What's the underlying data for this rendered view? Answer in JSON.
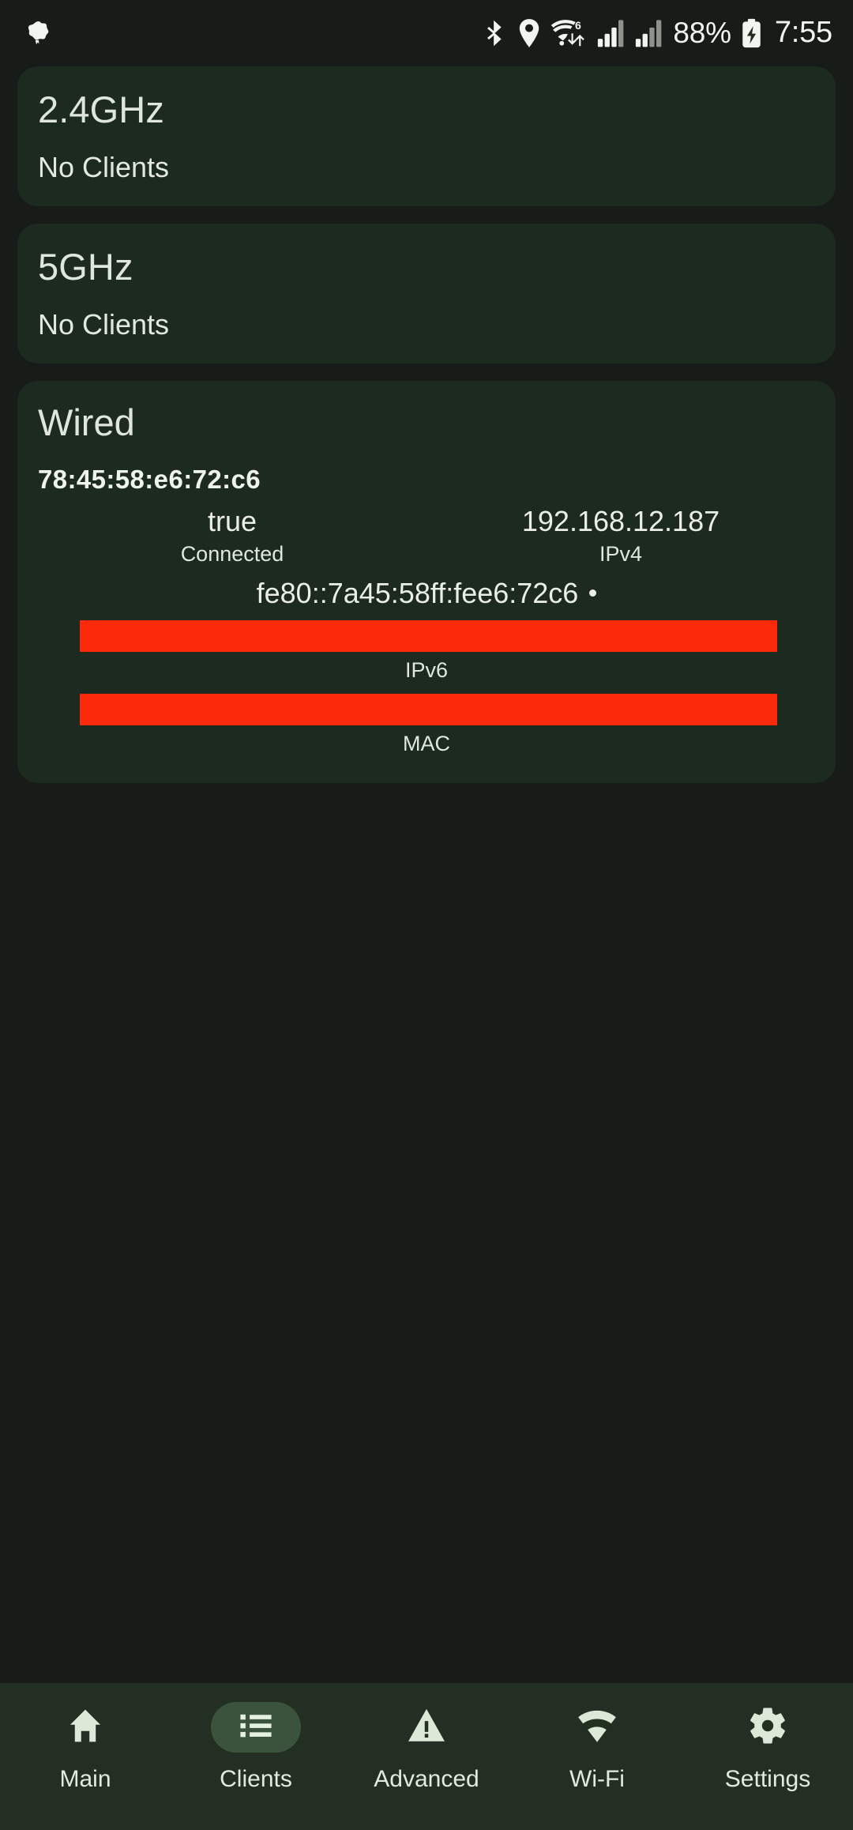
{
  "status_bar": {
    "left_icon": "app-notification-icon",
    "icons": [
      "bluetooth-icon",
      "location-pin-icon",
      "wifi-6-icon",
      "signal-bars-1-icon",
      "signal-bars-2-icon"
    ],
    "battery_percent": "88%",
    "battery_icon": "battery-charging-icon",
    "time": "7:55"
  },
  "cards": [
    {
      "title": "2.4GHz",
      "subtitle": "No Clients"
    },
    {
      "title": "5GHz",
      "subtitle": "No Clients"
    }
  ],
  "wired": {
    "title": "Wired",
    "mac_heading": "78:45:58:e6:72:c6",
    "connected_value": "true",
    "connected_label": "Connected",
    "ipv4_value": "192.168.12.187",
    "ipv4_label": "IPv4",
    "ipv6_value": "fe80::7a45:58ff:fee6:72c6",
    "ipv6_label": "IPv6",
    "mac_label": "MAC",
    "redaction_color": "#fc2a0b"
  },
  "nav": {
    "items": [
      {
        "label": "Main",
        "icon": "home-icon",
        "active": false
      },
      {
        "label": "Clients",
        "icon": "list-icon",
        "active": true
      },
      {
        "label": "Advanced",
        "icon": "warning-triangle-icon",
        "active": false
      },
      {
        "label": "Wi-Fi",
        "icon": "wifi-icon",
        "active": false
      },
      {
        "label": "Settings",
        "icon": "gear-icon",
        "active": false
      }
    ]
  },
  "colors": {
    "background": "#181c18",
    "card": "#1d2a1f",
    "navbar": "#222f22",
    "accent_pill": "#3b523c",
    "text": "#e3ebe0"
  }
}
